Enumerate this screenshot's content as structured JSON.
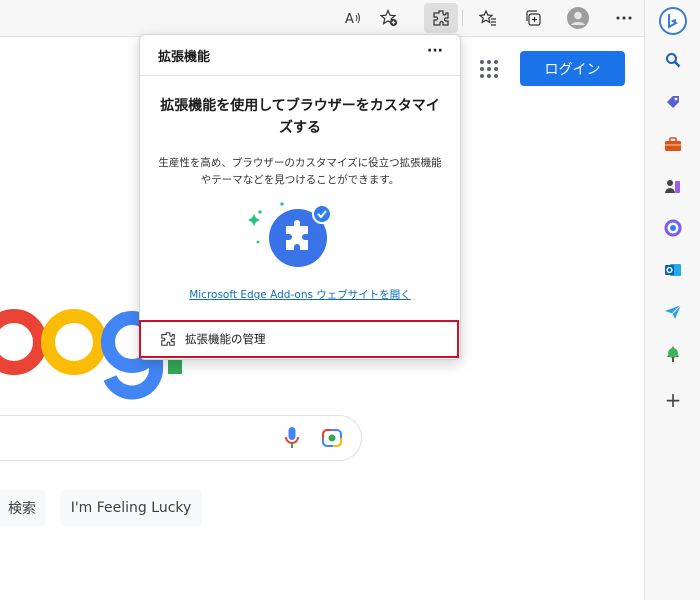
{
  "toolbar": {
    "read_aloud_icon": "read-aloud-icon",
    "favorite_add_icon": "add-favorite-icon",
    "extensions_icon": "extensions-icon",
    "favorites_icon": "favorites-icon",
    "collections_icon": "collections-icon",
    "profile_icon": "profile-icon",
    "more_icon": "more-icon"
  },
  "extensions_popup": {
    "title": "拡張機能",
    "more": "···",
    "heading": "拡張機能を使用してブラウザーをカスタマイズする",
    "description": "生産性を高め、ブラウザーのカスタマイズに役立つ拡張機能やテーマなどを見つけることができます。",
    "link": "Microsoft Edge Add-ons ウェブサイトを開く",
    "manage_label": "拡張機能の管理"
  },
  "google_page": {
    "login_label": "ログイン",
    "search_button": "検索",
    "lucky_button": "I'm Feeling Lucky"
  },
  "sidebar": {
    "items": [
      "search-icon",
      "tag-icon",
      "toolbox-icon",
      "games-icon",
      "copilot-icon",
      "outlook-icon",
      "send-icon",
      "tree-icon",
      "add-icon"
    ],
    "plus": "+"
  },
  "colors": {
    "accent_blue": "#1a73e8",
    "edge_link": "#0f6cbd",
    "highlight_red": "#d0102b"
  }
}
